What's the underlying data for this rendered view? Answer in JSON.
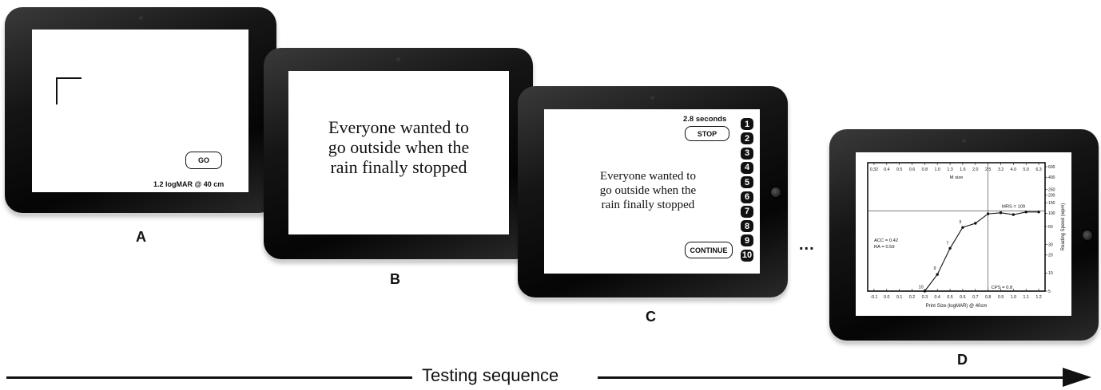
{
  "panel_a": {
    "label": "A",
    "go_button": "GO",
    "acuity_text": "1.2 logMAR @ 40 cm"
  },
  "panel_b": {
    "label": "B",
    "sentence_lines": [
      "Everyone wanted to",
      "go outside when the",
      "rain finally stopped"
    ]
  },
  "panel_c": {
    "label": "C",
    "timer_text": "2.8 seconds",
    "stop_button": "STOP",
    "continue_button": "CONTINUE",
    "sentence_lines": [
      "Everyone wanted to",
      "go outside when the",
      "rain finally stopped"
    ],
    "error_numbers": [
      "1",
      "2",
      "3",
      "4",
      "5",
      "6",
      "7",
      "8",
      "9",
      "10"
    ]
  },
  "panel_d": {
    "label": "D",
    "chart_data": {
      "type": "line",
      "xlabel": "Print Size (logMAR) @ 40cm",
      "ylabel": "Reading Speed (wpm)",
      "top_axis_label": "M size",
      "x_ticks": [
        "-0.1",
        "0.0",
        "0.1",
        "0.2",
        "0.3",
        "0.4",
        "0.5",
        "0.6",
        "0.7",
        "0.8",
        "0.9",
        "1.0",
        "1.1",
        "1.2"
      ],
      "top_ticks": [
        "0.32",
        "0.4",
        "0.5",
        "0.6",
        "0.8",
        "1.0",
        "1.3",
        "1.6",
        "2.0",
        "2.5",
        "3.2",
        "4.0",
        "5.0",
        "6.3"
      ],
      "y_ticks": [
        {
          "label": "600",
          "value": 600
        },
        {
          "label": "400",
          "value": 400
        },
        {
          "label": "250",
          "value": 250
        },
        {
          "label": "200",
          "value": 200
        },
        {
          "label": "150",
          "value": 150
        },
        {
          "label": "100",
          "value": 100
        },
        {
          "label": "60",
          "value": 60
        },
        {
          "label": "30",
          "value": 30
        },
        {
          "label": "20",
          "value": 20
        },
        {
          "label": "10",
          "value": 10
        },
        {
          "label": "5",
          "value": 5
        }
      ],
      "xlim": [
        -0.15,
        1.25
      ],
      "ylim": [
        5,
        700
      ],
      "y_scale": "log",
      "points": [
        {
          "x": 0.3,
          "y": 5
        },
        {
          "x": 0.4,
          "y": 9.5
        },
        {
          "x": 0.5,
          "y": 26
        },
        {
          "x": 0.6,
          "y": 58
        },
        {
          "x": 0.7,
          "y": 68
        },
        {
          "x": 0.8,
          "y": 98
        },
        {
          "x": 0.9,
          "y": 102
        },
        {
          "x": 1.0,
          "y": 95
        },
        {
          "x": 1.1,
          "y": 105
        },
        {
          "x": 1.2,
          "y": 105
        }
      ],
      "point_labels": [
        {
          "text": "10",
          "x": 0.27,
          "y": 5.6
        },
        {
          "text": "9",
          "x": 0.38,
          "y": 11.5
        },
        {
          "text": "7",
          "x": 0.48,
          "y": 30
        },
        {
          "text": "3",
          "x": 0.58,
          "y": 68
        }
      ],
      "annotations": {
        "mrs": "MRS = 109",
        "acc": "ACC = 0.42",
        "ra": "RA = 0.59",
        "cps": "CPS = 0.8"
      },
      "mrs_value": 109,
      "cps_value": 0.8
    }
  },
  "ellipsis": "...",
  "sequence_label": "Testing sequence"
}
